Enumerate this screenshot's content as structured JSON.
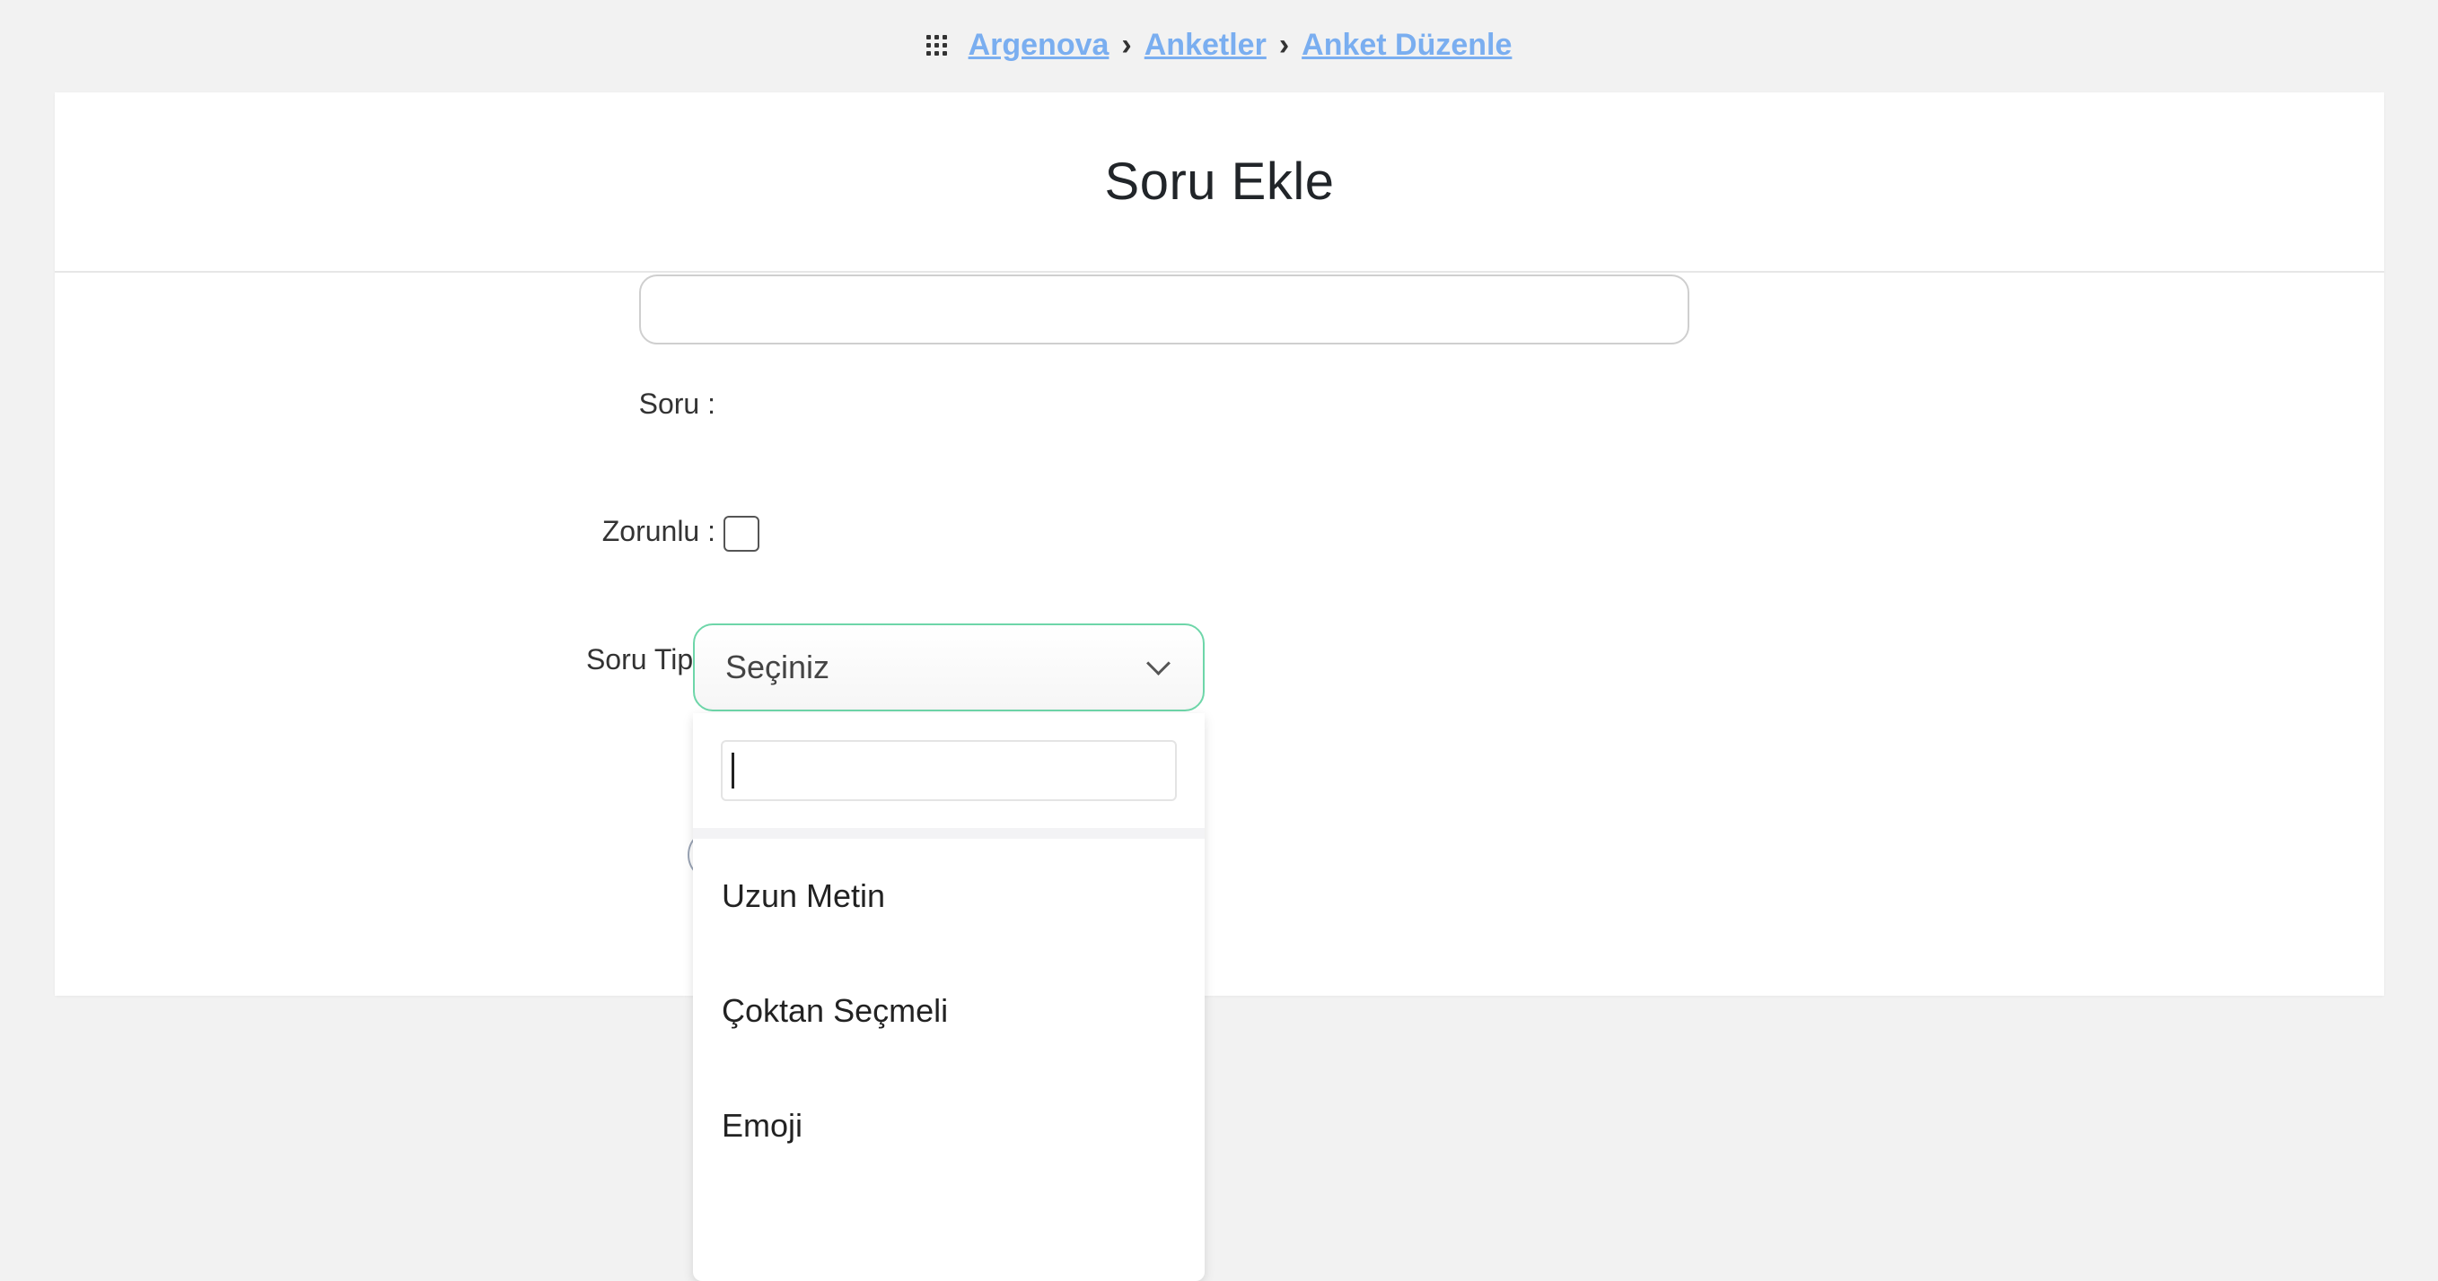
{
  "breadcrumb": {
    "items": [
      {
        "label": "Argenova"
      },
      {
        "label": "Anketler"
      },
      {
        "label": "Anket Düzenle"
      }
    ],
    "separator": "›"
  },
  "card": {
    "title": "Soru Ekle"
  },
  "form": {
    "soru_label": "Soru :",
    "soru_value": "",
    "zorunlu_label": "Zorunlu :",
    "zorunlu_checked": false,
    "soru_tipi_label": "Soru Tipi :",
    "soru_tipi_selected": "Seçiniz"
  },
  "dropdown": {
    "search_value": "",
    "options": [
      {
        "label": "Uzun Metin"
      },
      {
        "label": "Çoktan Seçmeli"
      },
      {
        "label": "Emoji"
      }
    ]
  },
  "colors": {
    "link": "#7aaef0",
    "select_border": "#6ed6a9",
    "background": "#f2f2f2"
  }
}
